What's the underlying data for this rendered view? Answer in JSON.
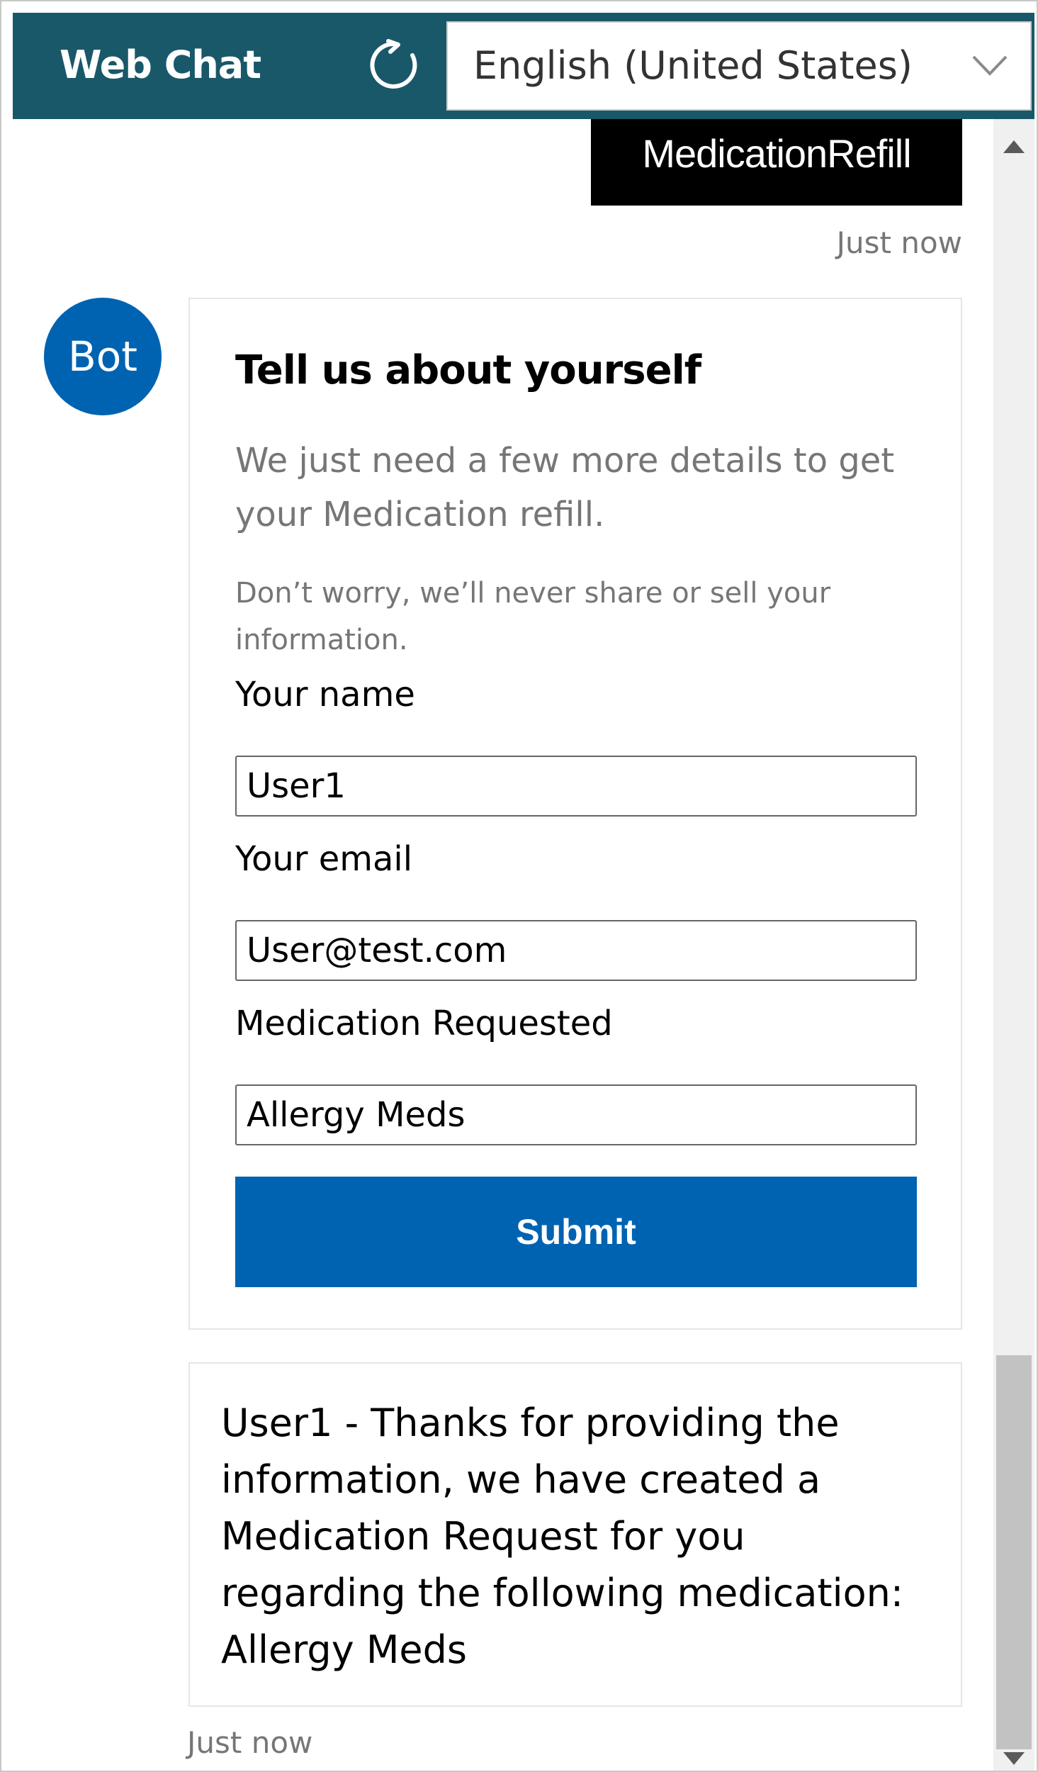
{
  "header": {
    "title": "Web Chat",
    "language": "English (United States)"
  },
  "messages": {
    "user_message": "MedicationRefill",
    "user_timestamp": "Just now",
    "bot_avatar": "Bot",
    "bot_timestamp": "Just now",
    "bot_reply": "User1 - Thanks for providing the information, we have created a Medication Request for you regarding the following medication: Allergy Meds"
  },
  "card": {
    "title": "Tell us about yourself",
    "subtitle": "We just need a few more details to get your Medication refill.",
    "note": "Don’t worry, we’ll never share or sell your information.",
    "name_label": "Your name",
    "name_value": "User1",
    "email_label": "Your email",
    "email_value": "User@test.com",
    "medication_label": "Medication Requested",
    "medication_value": "Allergy Meds",
    "submit_label": "Submit"
  },
  "icons": {
    "refresh": "refresh-icon",
    "chevron": "chevron-down-icon"
  },
  "colors": {
    "header_bg": "#195869",
    "accent": "#0063b1",
    "user_bubble": "#000000"
  }
}
